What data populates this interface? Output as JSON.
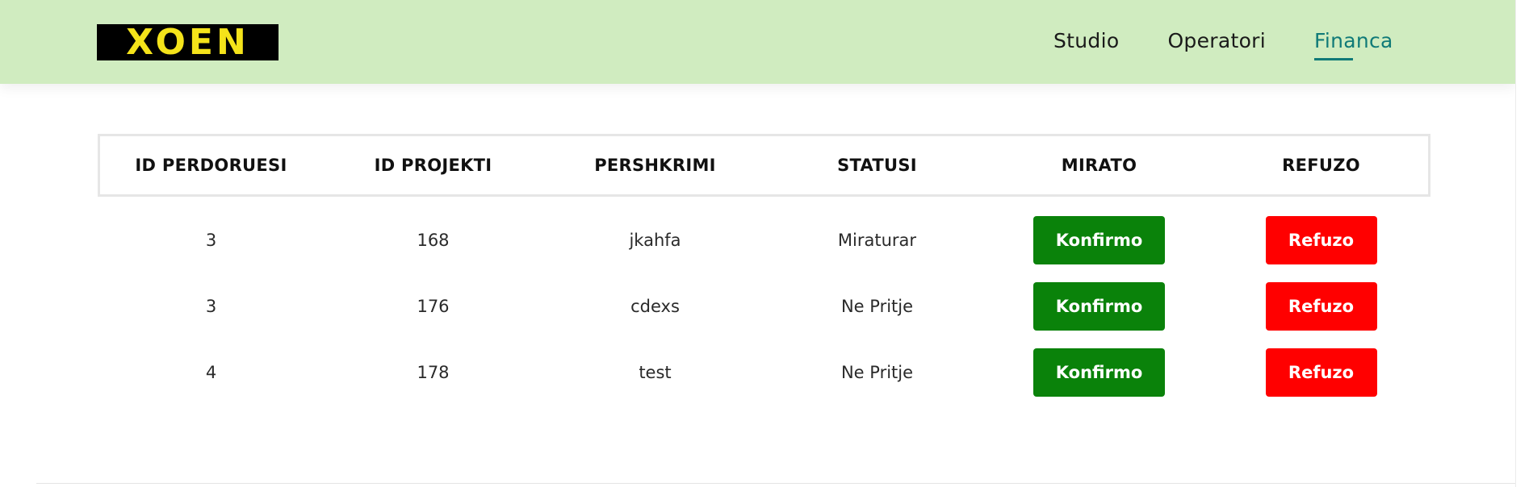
{
  "header": {
    "logo_text": "XOEN",
    "nav": [
      {
        "label": "Studio"
      },
      {
        "label": "Operatori"
      },
      {
        "label": "Financa",
        "active": true
      }
    ]
  },
  "colors": {
    "header_bg": "#d0ecc0",
    "logo_bg": "#000000",
    "logo_text": "#f4e31a",
    "nav_active": "#107a78",
    "confirm_btn": "#0a820a",
    "reject_btn": "#ff0000"
  },
  "table": {
    "headers": [
      "ID PERDORUESI",
      "ID PROJEKTI",
      "PERSHKRIMI",
      "STATUSI",
      "MIRATO",
      "REFUZO"
    ],
    "rows": [
      {
        "id_perdoruesi": "3",
        "id_projekti": "168",
        "pershkrimi": "jkahfa",
        "statusi": "Miraturar",
        "confirm_label": "Konfirmo",
        "reject_label": "Refuzo"
      },
      {
        "id_perdoruesi": "3",
        "id_projekti": "176",
        "pershkrimi": "cdexs",
        "statusi": "Ne Pritje",
        "confirm_label": "Konfirmo",
        "reject_label": "Refuzo"
      },
      {
        "id_perdoruesi": "4",
        "id_projekti": "178",
        "pershkrimi": "test",
        "statusi": "Ne Pritje",
        "confirm_label": "Konfirmo",
        "reject_label": "Refuzo"
      }
    ]
  }
}
